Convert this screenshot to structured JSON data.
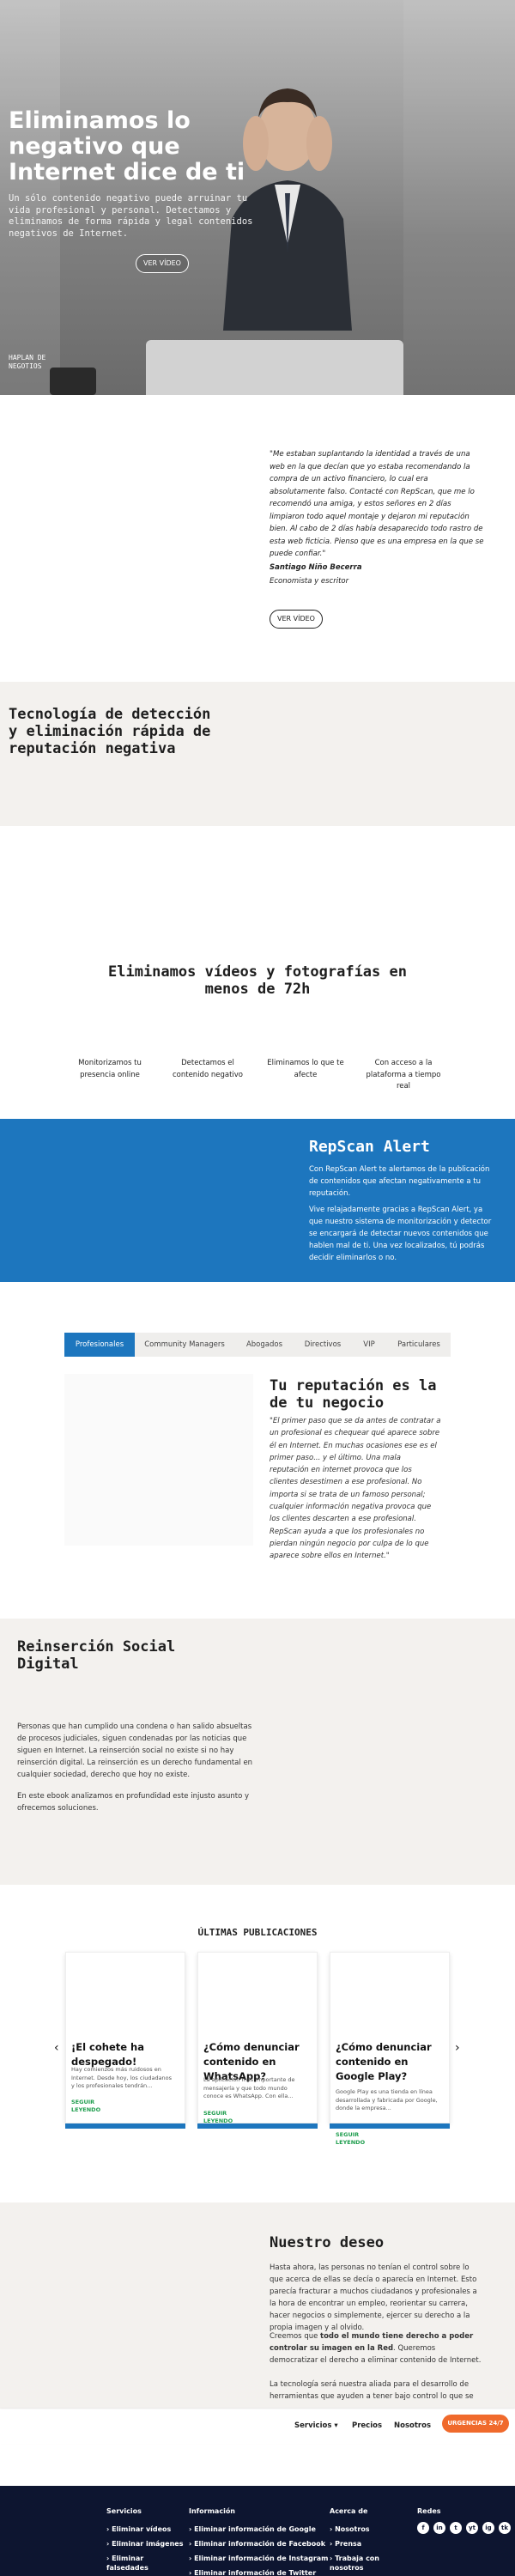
{
  "hero": {
    "title": "Eliminamos lo negativo que Internet dice de ti",
    "subtitle": "Un sólo contenido negativo puede arruinar tu vida profesional y personal. Detectamos y eliminamos de forma rápida y legal contenidos negativos de Internet.",
    "button": "VER VÍDEO",
    "logo_text": "HAPLAN DE NEGOTIOS"
  },
  "testimonial": {
    "quote": "\"Me estaban suplantando la identidad a través de una web en la que decían que yo estaba recomendando la compra de un activo financiero, lo cual era absolutamente falso. Contacté con RepScan, que me lo recomendó una amiga, y estos señores en 2 días limpiaron todo aquel montaje y dejaron mi reputación bien. Al cabo de 2 días había desaparecido todo rastro de esta web ficticia. Pienso que es una empresa en la que se puede confiar.\"",
    "name": "Santiago Niño Becerra",
    "role": "Economista y escritor",
    "button": "VER VÍDEO"
  },
  "tech": {
    "title": "Tecnología de detección y eliminación rápida de reputación negativa"
  },
  "features": {
    "title": "Eliminamos vídeos y fotografías en menos de 72h",
    "items": [
      "Monitorizamos tu presencia online",
      "Detectamos el contenido negativo",
      "Eliminamos lo que te afecte",
      "Con acceso a la plataforma a tiempo real"
    ]
  },
  "repscan": {
    "title": "RepScan Alert",
    "p1": "Con RepScan Alert te alertamos de la publicación de contenidos que afectan negativamente a tu reputación.",
    "p2": "Vive relajadamente gracias a RepScan Alert, ya que nuestro sistema de monitorización y detector se encargará de detectar nuevos contenidos que hablen mal de ti. Una vez localizados, tú podrás decidir eliminarlos o no."
  },
  "tabs": {
    "items": [
      "Profesionales",
      "Community Managers",
      "Abogados",
      "Directivos",
      "VIP",
      "Particulares"
    ],
    "active": 0,
    "heading": "Tu reputación es la de tu negocio",
    "text": "\"El primer paso que se da antes de contratar a un profesional es chequear qué aparece sobre él en Internet. En muchas ocasiones ese es el primer paso... y el último. Una mala reputación en internet provoca que los clientes desestimen a ese profesional. No importa si se trata de un famoso personal; cualquier información negativa provoca que los clientes descarten a ese profesional. RepScan ayuda a que los profesionales no pierdan ningún negocio por culpa de lo que aparece sobre ellos en Internet.\""
  },
  "reinsercion": {
    "title": "Reinserción Social Digital",
    "p1": "Personas que han cumplido una condena o han salido absueltas de procesos judiciales, siguen condenadas por las noticias que siguen en Internet. La reinserción social no existe si no hay reinserción digital. La reinserción es un derecho fundamental en cualquier sociedad, derecho que hoy no existe.",
    "p2": "En este ebook analizamos en profundidad este injusto asunto y ofrecemos soluciones."
  },
  "publications": {
    "title": "ÚLTIMAS PUBLICACIONES",
    "cards": [
      {
        "title": "¡El cohete ha despegado!",
        "excerpt": "Hay comienzos más ruidosos en Internet. Desde hoy, los ciudadanos y los profesionales tendrán...",
        "more": "SEGUIR LEYENDO"
      },
      {
        "title": "¿Cómo denunciar contenido en WhatsApp?",
        "excerpt": "La aplicación más importante de mensajería y que todo mundo conoce es WhatsApp. Con ella...",
        "more": "SEGUIR LEYENDO"
      },
      {
        "title": "¿Cómo denunciar contenido en Google Play?",
        "excerpt": "Google Play es una tienda en línea desarrollada y fabricada por Google, donde la empresa...",
        "more": "SEGUIR LEYENDO"
      }
    ],
    "prev": "‹",
    "next": "›"
  },
  "deseo": {
    "title": "Nuestro deseo",
    "p1": "Hasta ahora, las personas no tenían el control sobre lo que acerca de ellas se decía o aparecía en Internet. Esto parecía fracturar a muchos ciudadanos y profesionales a la hora de encontrar un empleo, reorientar su carrera, hacer negocios o simplemente, ejercer su derecho a la propia imagen y al olvido.",
    "p2_pre": "Creemos que ",
    "p2_bold": "todo el mundo tiene derecho a poder controlar su imagen en la Red",
    "p2_post": ". Queremos democratizar el derecho a eliminar contenido de Internet.",
    "p3": "La tecnología será nuestra aliada para el desarrollo de herramientas que ayuden a tener bajo control lo que se"
  },
  "bottom_nav": {
    "items": [
      "Servicios",
      "Precios",
      "Nosotros"
    ],
    "cta": "URGENCIAS 24/7"
  },
  "footer": {
    "columns": [
      {
        "heading": "Servicios",
        "links": [
          "Eliminar vídeos",
          "Eliminar imágenes",
          "Eliminar falsedades"
        ]
      },
      {
        "heading": "Información",
        "links": [
          "Eliminar información de Google",
          "Eliminar información de Facebook",
          "Eliminar información de Instagram",
          "Eliminar información de Twitter"
        ]
      },
      {
        "heading": "Acerca de",
        "links": [
          "Nosotros",
          "Prensa",
          "Trabaja con nosotros"
        ]
      },
      {
        "heading": "Redes",
        "links": []
      }
    ],
    "social": [
      "f",
      "in",
      "t",
      "yt",
      "ig",
      "tk"
    ]
  },
  "colors": {
    "brand_blue": "#1d76be",
    "cta_orange": "#f06a2c",
    "footer_navy": "#0d1530",
    "section_beige": "#f3f1ee",
    "link_green": "#1f9e4e"
  }
}
